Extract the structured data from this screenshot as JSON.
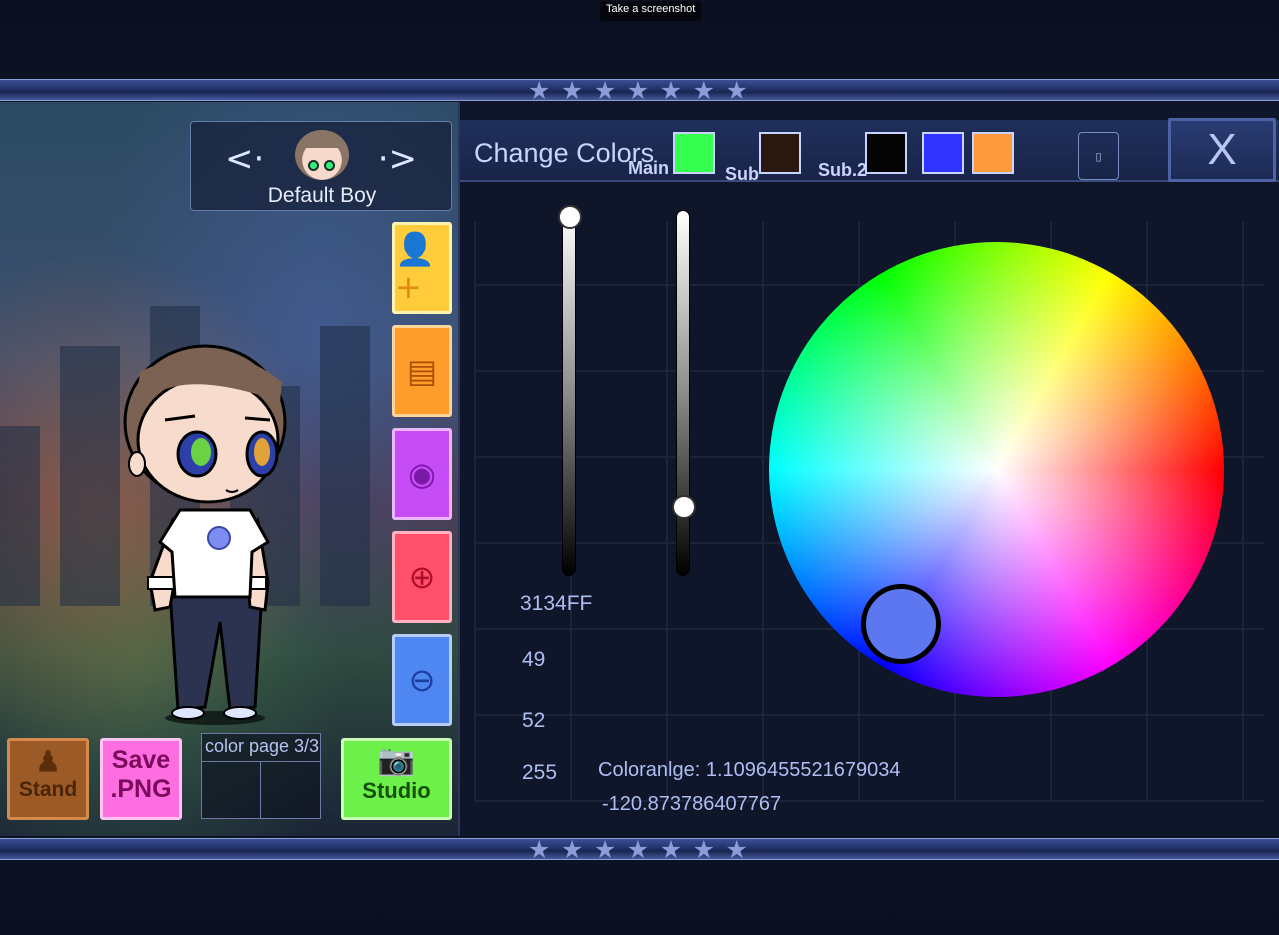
{
  "tooltip": "Take a screenshot",
  "character": {
    "name": "Default Boy",
    "prev_arrow": "<·",
    "next_arrow": "·>"
  },
  "side_buttons": [
    {
      "name": "add-character",
      "icon": "add-user-icon",
      "color": "#ffcd3c"
    },
    {
      "name": "background",
      "icon": "scene-icon",
      "color": "#ff9d2c"
    },
    {
      "name": "toggle-view",
      "icon": "eye-icon",
      "color": "#c64cf5"
    },
    {
      "name": "zoom-in",
      "icon": "zoom-in-icon",
      "color": "#ff4f6a"
    },
    {
      "name": "zoom-out",
      "icon": "zoom-out-icon",
      "color": "#4e86f2"
    }
  ],
  "bottom_buttons": {
    "stand": "Stand",
    "save_line1": "Save",
    "save_line2": ".PNG",
    "color_page": "color page 3/3",
    "studio": "Studio"
  },
  "panel": {
    "title": "Change Colors",
    "swatches": [
      {
        "label": "Main",
        "color": "#35ff4f"
      },
      {
        "label": "Sub",
        "color": "#2a1810"
      },
      {
        "label": "Sub.2",
        "color": "#050505"
      },
      {
        "label": "",
        "color": "#3134ff"
      },
      {
        "label": "",
        "color": "#ff9a3c"
      }
    ],
    "close_label": "X",
    "small_button_label": "▯"
  },
  "color_values": {
    "hex": "3134FF",
    "r": "49",
    "g": "52",
    "b": "255",
    "angle_line1": "Coloranlge: 1.1096455521679034",
    "angle_line2": "-120.873786407767"
  },
  "sliders": {
    "brightness": 1.0,
    "saturation": 0.2
  },
  "colors": {
    "selected": "#3134ff",
    "band": "#24356e",
    "panel_bg": "#0f1629"
  }
}
